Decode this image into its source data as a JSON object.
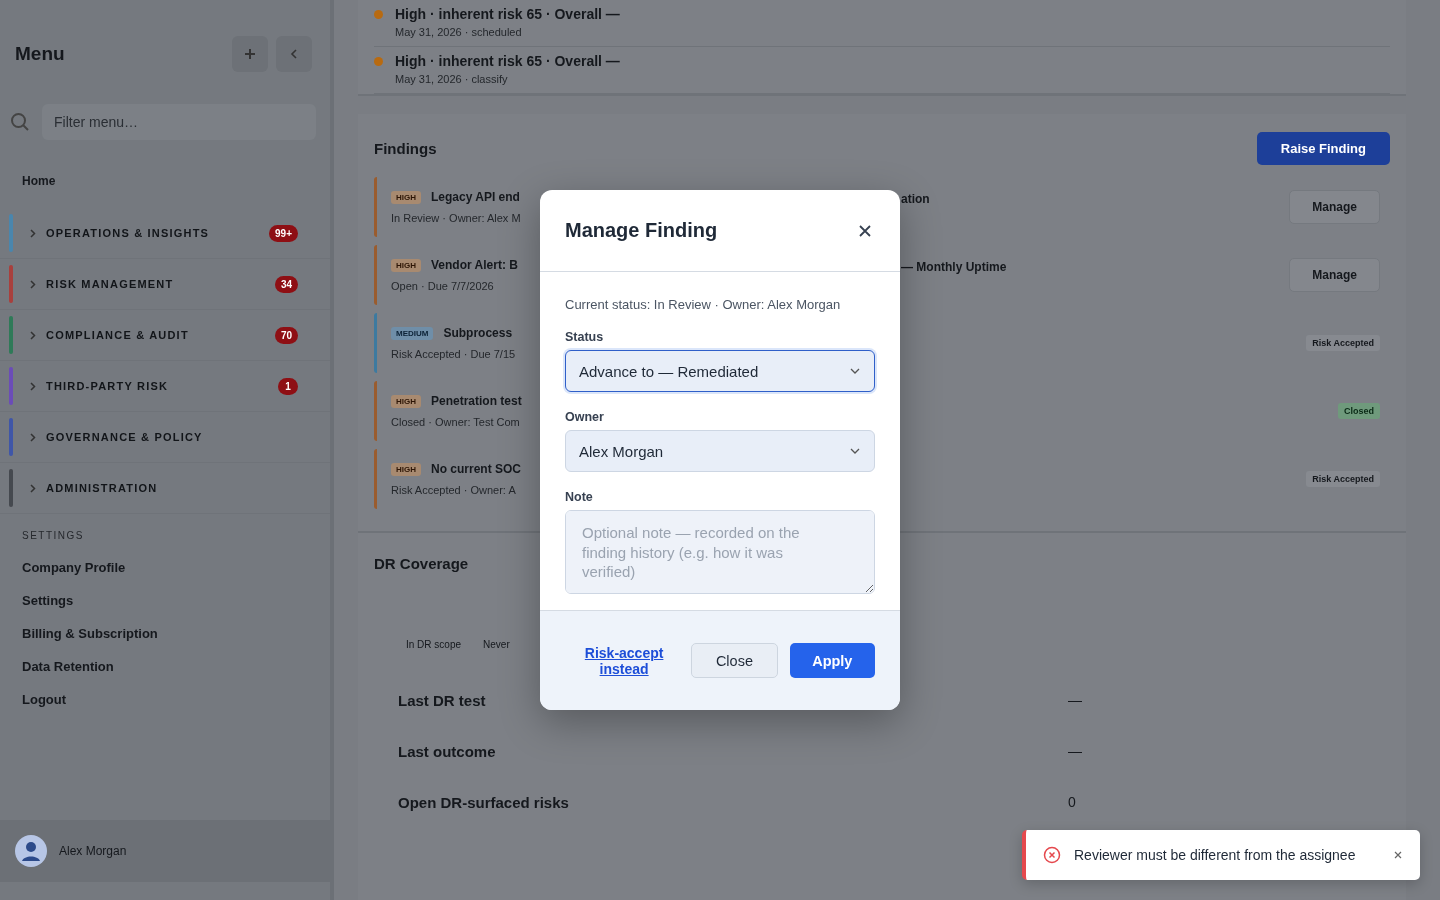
{
  "sidebar": {
    "title": "Menu",
    "filter": {
      "placeholder": "Filter menu…"
    },
    "home": "Home",
    "groups": [
      {
        "label": "OPERATIONS & INSIGHTS",
        "color": "#4a86ad",
        "badge": "99+"
      },
      {
        "label": "RISK MANAGEMENT",
        "color": "#a8403d",
        "badge": "34"
      },
      {
        "label": "COMPLIANCE & AUDIT",
        "color": "#2f7a58",
        "badge": "70"
      },
      {
        "label": "THIRD-PARTY RISK",
        "color": "#6b4cb8",
        "badge": "1"
      },
      {
        "label": "GOVERNANCE & POLICY",
        "color": "#3f56a8"
      },
      {
        "label": "ADMINISTRATION",
        "color": "#45494f"
      }
    ],
    "settings_heading": "SETTINGS",
    "settings_items": [
      "Company Profile",
      "Settings",
      "Billing & Subscription",
      "Data Retention",
      "Logout"
    ],
    "user": "Alex Morgan"
  },
  "activity": [
    {
      "title": "High · inherent risk 65 · Overall —",
      "meta": "May 31, 2026 · scheduled",
      "color": "#b86a10"
    },
    {
      "title": "High · inherent risk 65 · Overall —",
      "meta": "May 31, 2026 · classify",
      "color": "#b86a10"
    }
  ],
  "findings": {
    "title": "Findings",
    "raise_button": "Raise Finding",
    "rows": [
      {
        "severity": "HIGH",
        "color": "#9a5c2e",
        "title": "Legacy API end",
        "title_tail": "ation",
        "meta": "In Review · Owner: Alex M",
        "action": {
          "kind": "button",
          "label": "Manage"
        }
      },
      {
        "severity": "HIGH",
        "color": "#9a5c2e",
        "title": "Vendor Alert: B",
        "title_tail": "— Monthly Uptime",
        "meta": "Open · Due 7/7/2026",
        "action": {
          "kind": "button",
          "label": "Manage"
        }
      },
      {
        "severity": "MEDIUM",
        "color": "#3d7aa0",
        "title": "Subprocess",
        "meta": "Risk Accepted · Due 7/15",
        "action": {
          "kind": "tag",
          "label": "Risk Accepted"
        }
      },
      {
        "severity": "HIGH",
        "color": "#9a5c2e",
        "title": "Penetration test",
        "meta": "Closed · Owner: Test Com",
        "action": {
          "kind": "success",
          "label": "Closed"
        }
      },
      {
        "severity": "HIGH",
        "color": "#9a5c2e",
        "title": "No current SOC",
        "meta": "Risk Accepted · Owner: A",
        "action": {
          "kind": "tag",
          "label": "Risk Accepted"
        }
      }
    ]
  },
  "dr_coverage": {
    "title": "DR Coverage",
    "tabs": [
      "In DR scope",
      "Never"
    ],
    "rows": [
      {
        "label": "Last DR test",
        "value": "—"
      },
      {
        "label": "Last outcome",
        "value": "—"
      },
      {
        "label": "Open DR-surfaced risks",
        "value": "0"
      }
    ]
  },
  "dialog": {
    "title": "Manage Finding",
    "current": "Current status: In Review · Owner: Alex Morgan",
    "status": {
      "label": "Status",
      "value": "Advance to — Remediated"
    },
    "owner": {
      "label": "Owner",
      "value": "Alex Morgan"
    },
    "note": {
      "label": "Note",
      "placeholder": "Optional note — recorded on the finding history (e.g. how it was verified)"
    },
    "link": "Risk-accept instead",
    "close_button": "Close",
    "apply_button": "Apply"
  },
  "toast": {
    "kind": "error",
    "message": "Reviewer must be different from the assignee"
  }
}
